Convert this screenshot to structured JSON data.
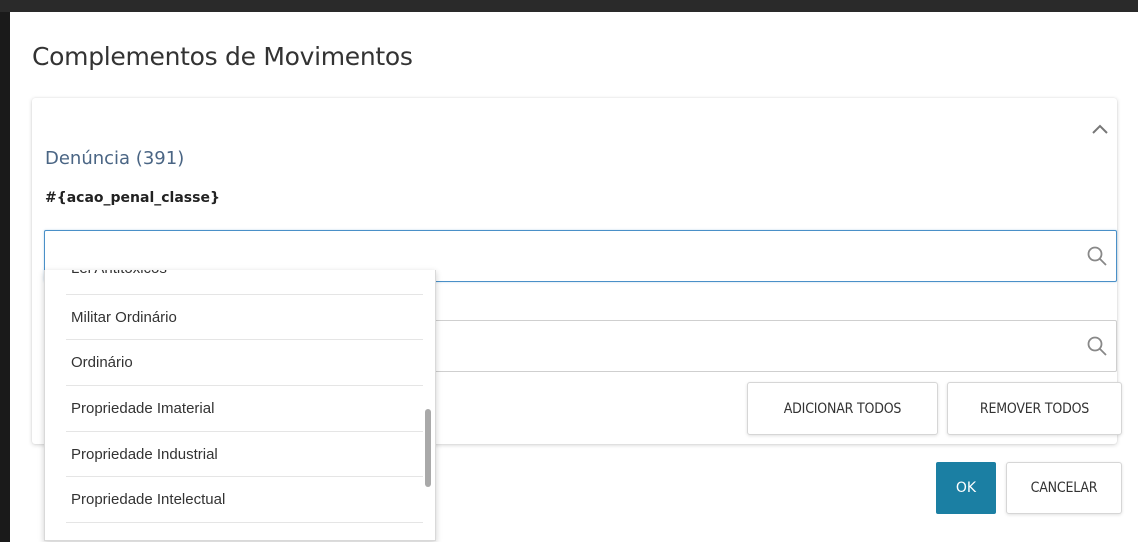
{
  "dialog": {
    "title": "Complementos de Movimentos",
    "section_title": "Denúncia (391)",
    "field_label": "#{acao_penal_classe}",
    "field_value": "",
    "second_field_value": ""
  },
  "dropdown": {
    "options": [
      "Lei Antitóxicos",
      "Militar Ordinário",
      "Ordinário",
      "Propriedade Imaterial",
      "Propriedade Industrial",
      "Propriedade Intelectual"
    ]
  },
  "buttons": {
    "add_all": "ADICIONAR TODOS",
    "remove_all": "REMOVER TODOS",
    "ok": "OK",
    "cancel": "CANCELAR"
  },
  "icons": {
    "collapse": "chevron-up-icon",
    "search": "search-icon"
  },
  "colors": {
    "primary": "#1b7fa3",
    "section_title": "#4a6584",
    "focus_border": "#4a90c8"
  }
}
